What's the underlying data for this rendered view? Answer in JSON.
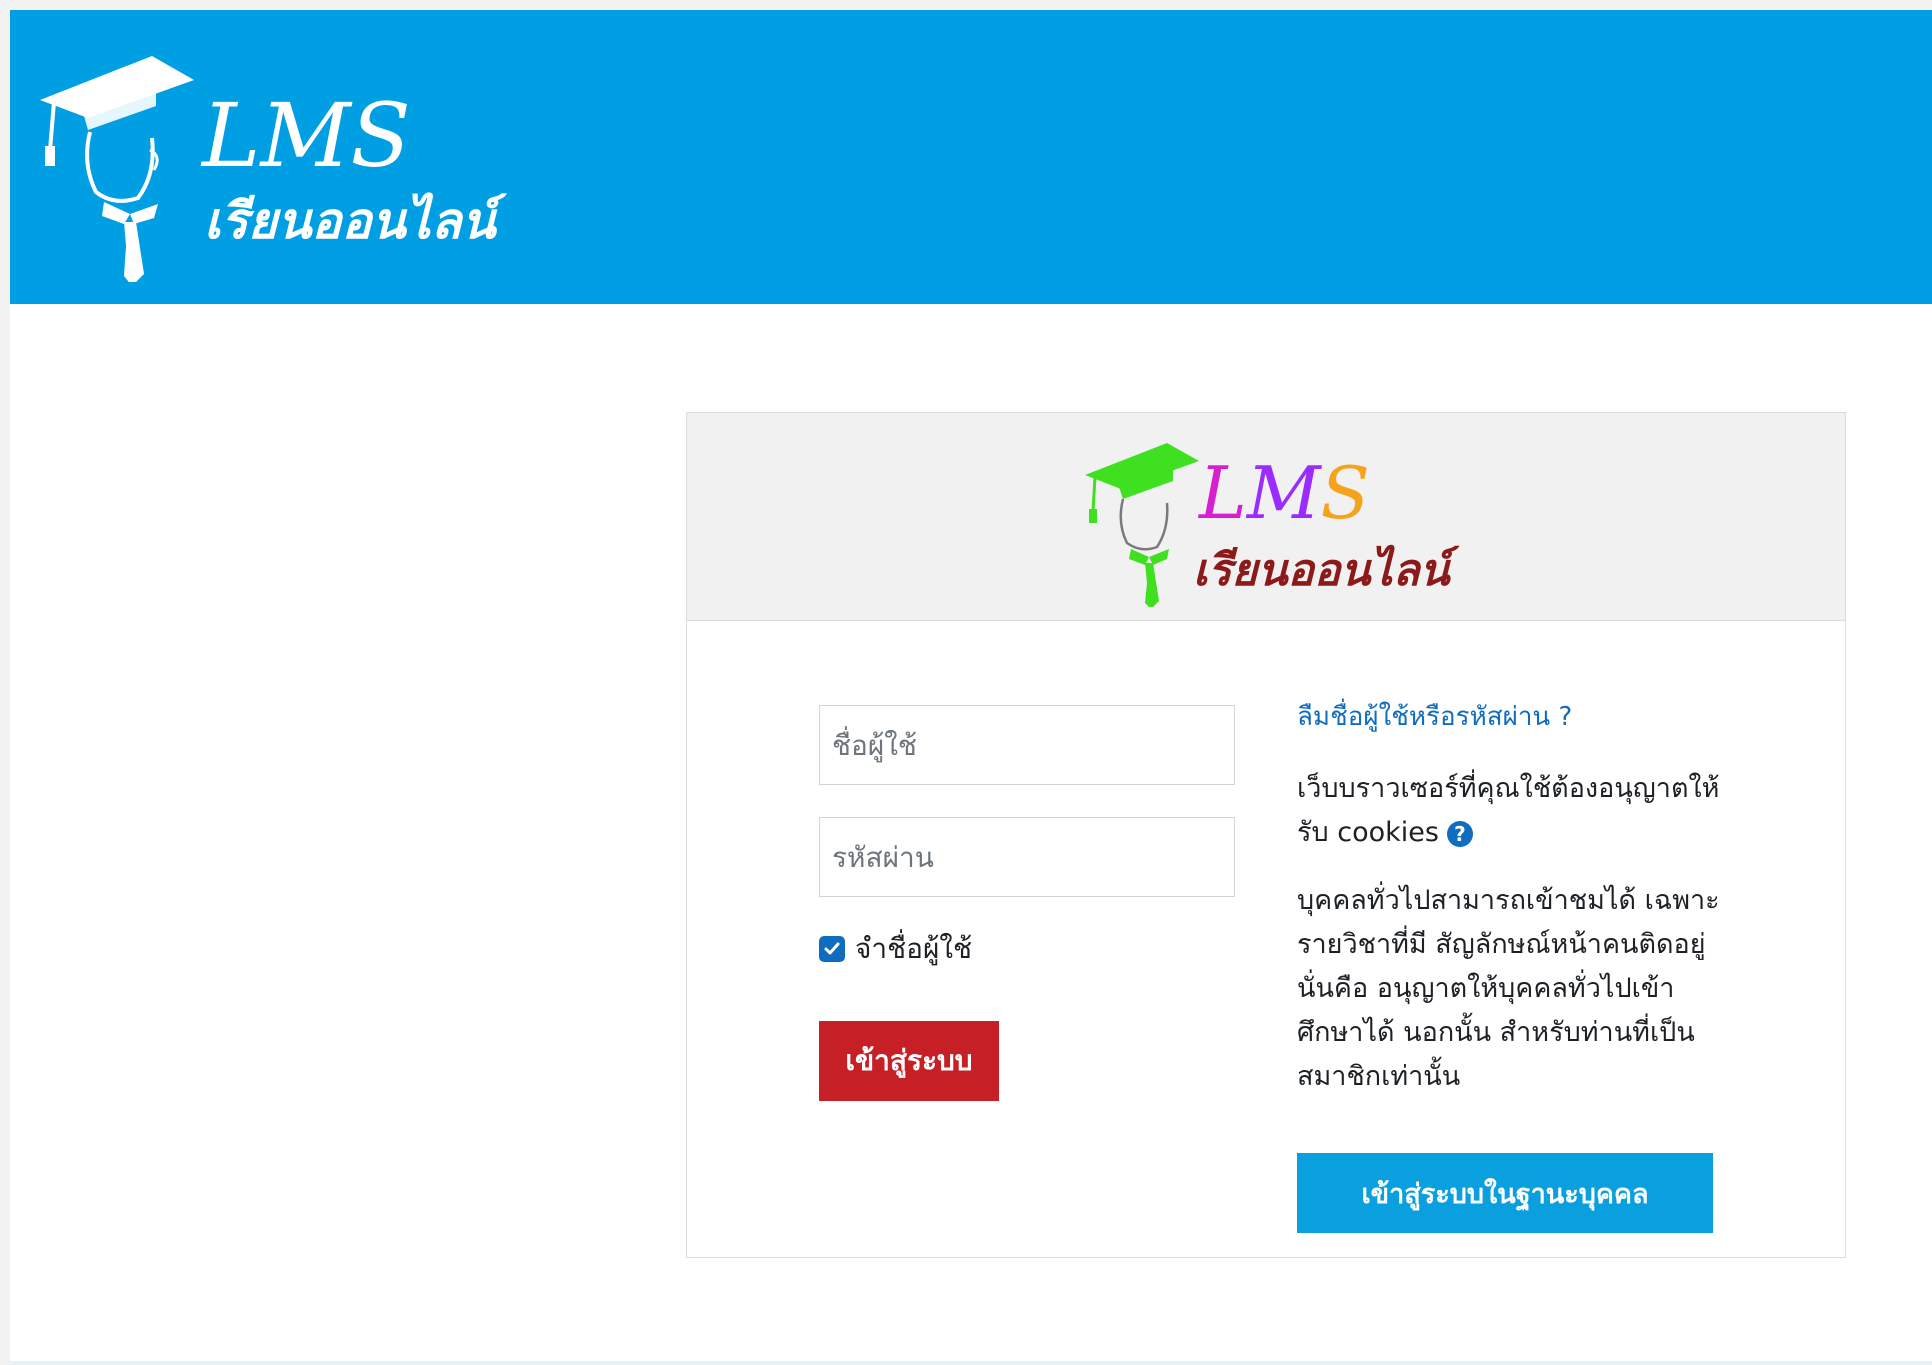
{
  "header": {
    "logo": {
      "title": "LMS",
      "subtitle": "เรียนออนไลน์"
    },
    "background_color": "#009fe3"
  },
  "card": {
    "logo": {
      "title_letters": [
        "L",
        "M",
        "S"
      ],
      "subtitle": "เรียนออนไลน์",
      "colors": [
        "#d61fd1",
        "#9b2cff",
        "#f5a31a",
        "#8b1a1a",
        "#3fe01f"
      ]
    },
    "login_form": {
      "username_placeholder": "ชื่อผู้ใช้",
      "password_placeholder": "รหัสผ่าน",
      "remember_label": "จำชื่อผู้ใช้",
      "remember_checked": true,
      "login_button": "เข้าสู่ระบบ"
    },
    "info": {
      "forgot_link": "ลืมชื่อผู้ใช้หรือรหัสผ่าน ?",
      "cookie_text": "เว็บบราวเซอร์ที่คุณใช้ต้องอนุญาตให้รับ cookies",
      "guest_text": "บุคคลทั่วไปสามารถเข้าชมได้ เฉพาะรายวิชาที่มี สัญลักษณ์หน้าคนติดอยู่ นั่นคือ อนุญาตให้บุคคลทั่วไปเข้าศึกษาได้ นอกนั้น สำหรับท่านที่เป็นสมาชิกเท่านั้น",
      "guest_button": "เข้าสู่ระบบในฐานะบุคคล"
    },
    "icons": {
      "help": "question-circle-icon",
      "checkbox": "check-icon"
    }
  },
  "colors": {
    "login_button": "#c71f26",
    "guest_button": "#0aa0e0",
    "link": "#0f6cbf"
  }
}
